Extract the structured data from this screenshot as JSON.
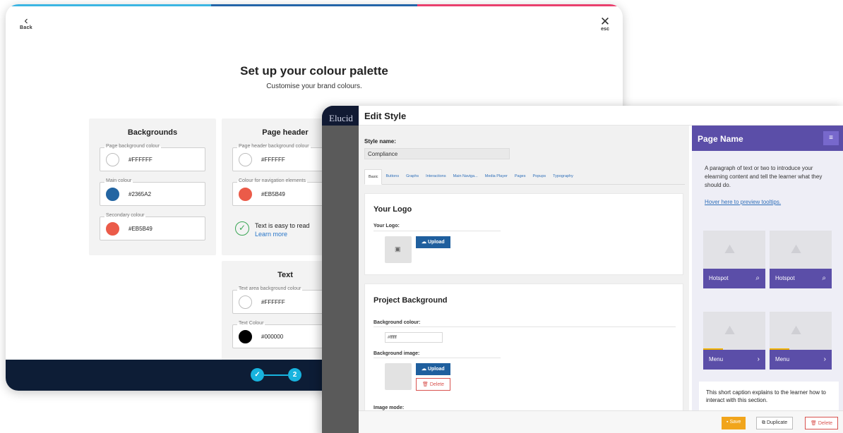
{
  "colors": {
    "bar": [
      "#3bb5e3",
      "#2465a8",
      "#e9406d"
    ],
    "footer": "#0d1d36",
    "step": "#18b3de",
    "preview_header": "#5b4ea8"
  },
  "wizard": {
    "back_label": "Back",
    "back_icon": "chevron-left-icon",
    "esc_label": "esc",
    "close_icon": "close-icon",
    "title": "Set up your colour palette",
    "subtitle": "Customise your brand colours.",
    "backgrounds": {
      "heading": "Backgrounds",
      "fields": [
        {
          "label": "Page background colour",
          "value": "#FFFFFF",
          "swatch": "#FFFFFF"
        },
        {
          "label": "Main colour",
          "value": "#2365A2",
          "swatch": "#2365A2"
        },
        {
          "label": "Secondary colour",
          "value": "#EB5B49",
          "swatch": "#EB5B49"
        }
      ]
    },
    "page_header": {
      "heading": "Page header",
      "fields": [
        {
          "label": "Page header background colour",
          "value": "#FFFFFF",
          "swatch": "#FFFFFF"
        },
        {
          "label": "Colour for navigation elements",
          "value": "#EB5B49",
          "swatch": "#EB5B49"
        }
      ],
      "readability": "Text is easy to read",
      "learn_more": "Learn more"
    },
    "text": {
      "heading": "Text",
      "fields": [
        {
          "label": "Text area background colour",
          "value": "#FFFFFF",
          "swatch": "#FFFFFF"
        },
        {
          "label": "Text Colour",
          "value": "#000000",
          "swatch": "#000000"
        }
      ]
    },
    "steps": [
      {
        "label": "✓",
        "state": "done"
      },
      {
        "label": "2",
        "state": "current"
      }
    ]
  },
  "edit_style": {
    "window_title": "Edit Style",
    "strip_logo": "Elucid",
    "style_name_label": "Style name:",
    "style_name_value": "Compliance",
    "tabs": [
      "Basic",
      "Buttons",
      "Graphs",
      "Interactions",
      "Main Naviga...",
      "Media Player",
      "Pages",
      "Popups",
      "Typography"
    ],
    "logo_section": {
      "title": "Your Logo",
      "field_label": "Your Logo:",
      "upload": "Upload"
    },
    "background_section": {
      "title": "Project Background",
      "colour_label": "Background colour:",
      "colour_value": "#ffffff",
      "image_label": "Background image:",
      "upload": "Upload",
      "delete": "Delete",
      "mode_label": "Image mode:"
    },
    "preview": {
      "page_name": "Page Name",
      "menu_icon": "≡",
      "paragraph": "A paragraph of text or two to introduce your elearning content and tell the learner what they should do.",
      "tooltip_link": "Hover here to preview tooltips.",
      "hotspots": [
        "Hotspot",
        "Hotspot"
      ],
      "menus": [
        "Menu",
        "Menu"
      ],
      "caption": "This short caption explains to the learner how to interact with this section."
    },
    "actions": {
      "save": "Save",
      "duplicate": "Duplicate",
      "delete": "Delete"
    }
  }
}
